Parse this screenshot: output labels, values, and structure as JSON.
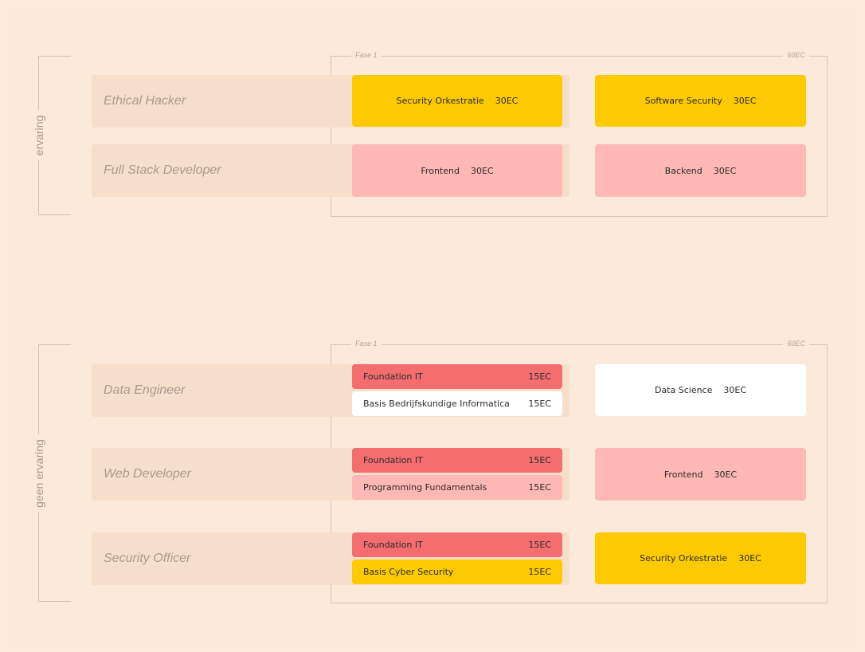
{
  "colors": {
    "background": "#fbe9da",
    "row": "#f6dfca",
    "yellow": "#fdca00",
    "pink": "#ffb8b6",
    "red": "#f46e70",
    "white": "#ffffff"
  },
  "top": {
    "group_label": "ervaring",
    "phase_label": "Fase 1",
    "total_label": "60EC",
    "rows": [
      {
        "role": "Ethical Hacker",
        "left": {
          "name": "Security Orkestratie",
          "ec": "30EC"
        },
        "right": {
          "name": "Software Security",
          "ec": "30EC"
        }
      },
      {
        "role": "Full Stack Developer",
        "left": {
          "name": "Frontend",
          "ec": "30EC"
        },
        "right": {
          "name": "Backend",
          "ec": "30EC"
        }
      }
    ]
  },
  "bottom": {
    "group_label": "geen ervaring",
    "phase_label": "Fase 1",
    "total_label": "60EC",
    "rows": [
      {
        "role": "Data Engineer",
        "top_half": {
          "name": "Foundation IT",
          "ec": "15EC"
        },
        "bottom_half": {
          "name": "Basis Bedrijfskundige Informatica",
          "ec": "15EC"
        },
        "right": {
          "name": "Data Science",
          "ec": "30EC"
        }
      },
      {
        "role": "Web Developer",
        "top_half": {
          "name": "Foundation IT",
          "ec": "15EC"
        },
        "bottom_half": {
          "name": "Programming Fundamentals",
          "ec": "15EC"
        },
        "right": {
          "name": "Frontend",
          "ec": "30EC"
        }
      },
      {
        "role": "Security Officer",
        "top_half": {
          "name": "Foundation IT",
          "ec": "15EC"
        },
        "bottom_half": {
          "name": "Basis Cyber Security",
          "ec": "15EC"
        },
        "right": {
          "name": "Security Orkestratie",
          "ec": "30EC"
        }
      }
    ]
  }
}
